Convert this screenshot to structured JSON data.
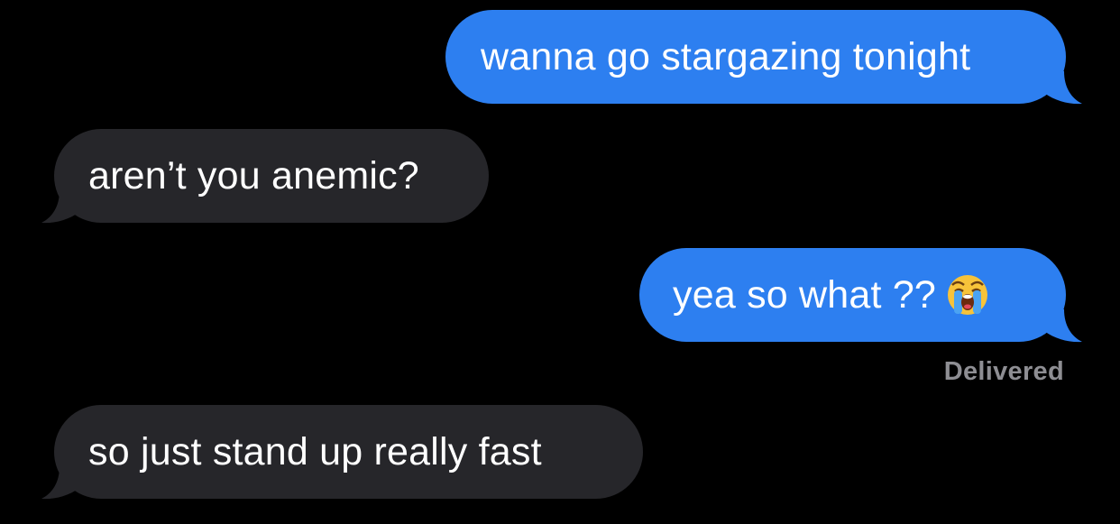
{
  "conversation": {
    "messages": [
      {
        "direction": "outgoing",
        "text": "wanna go stargazing tonight"
      },
      {
        "direction": "incoming",
        "text": "aren’t you anemic?"
      },
      {
        "direction": "outgoing",
        "text": "yea so what ??",
        "emoji": "loudly-crying-face-icon"
      },
      {
        "direction": "incoming",
        "text": "so just stand up really fast"
      }
    ],
    "status": "Delivered"
  },
  "colors": {
    "background": "#000000",
    "outgoing_bubble": "#2d7ff0",
    "incoming_bubble": "#26262a",
    "status_text": "#8e8e93"
  }
}
